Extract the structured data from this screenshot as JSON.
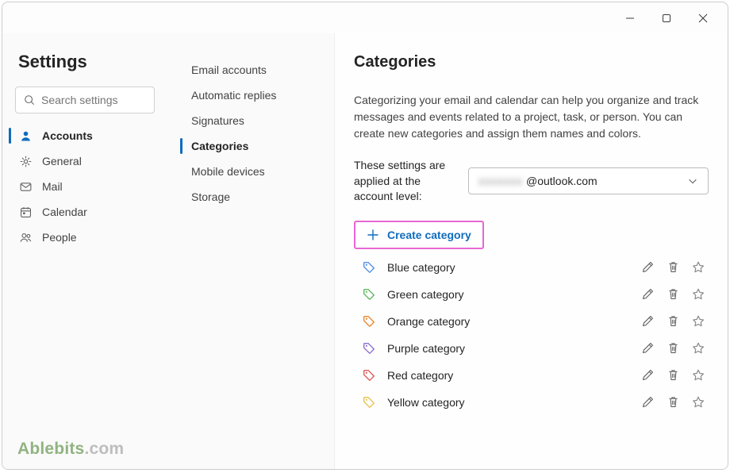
{
  "window": {
    "title": "Settings"
  },
  "sidebar": {
    "heading": "Settings",
    "search_placeholder": "Search settings",
    "items": [
      {
        "label": "Accounts",
        "icon": "person-icon",
        "active": true
      },
      {
        "label": "General",
        "icon": "gear-icon"
      },
      {
        "label": "Mail",
        "icon": "mail-icon"
      },
      {
        "label": "Calendar",
        "icon": "calendar-icon"
      },
      {
        "label": "People",
        "icon": "people-icon"
      }
    ]
  },
  "subnav": {
    "items": [
      {
        "label": "Email accounts"
      },
      {
        "label": "Automatic replies"
      },
      {
        "label": "Signatures"
      },
      {
        "label": "Categories",
        "active": true
      },
      {
        "label": "Mobile devices"
      },
      {
        "label": "Storage"
      }
    ]
  },
  "content": {
    "heading": "Categories",
    "description": "Categorizing your email and calendar can help you organize and track messages and events related to a project, task, or person. You can create new categories and assign them names and colors.",
    "account_label": "These settings are applied at the account level:",
    "account_domain": "@outlook.com",
    "create_label": "Create category",
    "categories": [
      {
        "name": "Blue category",
        "color": "#4f8fe6"
      },
      {
        "name": "Green category",
        "color": "#5fb85f"
      },
      {
        "name": "Orange category",
        "color": "#e8872f"
      },
      {
        "name": "Purple category",
        "color": "#8d6fd1"
      },
      {
        "name": "Red category",
        "color": "#dd5a5a"
      },
      {
        "name": "Yellow category",
        "color": "#eac04e"
      }
    ]
  },
  "watermark": {
    "brand": "Ablebits",
    "suffix": ".com"
  }
}
